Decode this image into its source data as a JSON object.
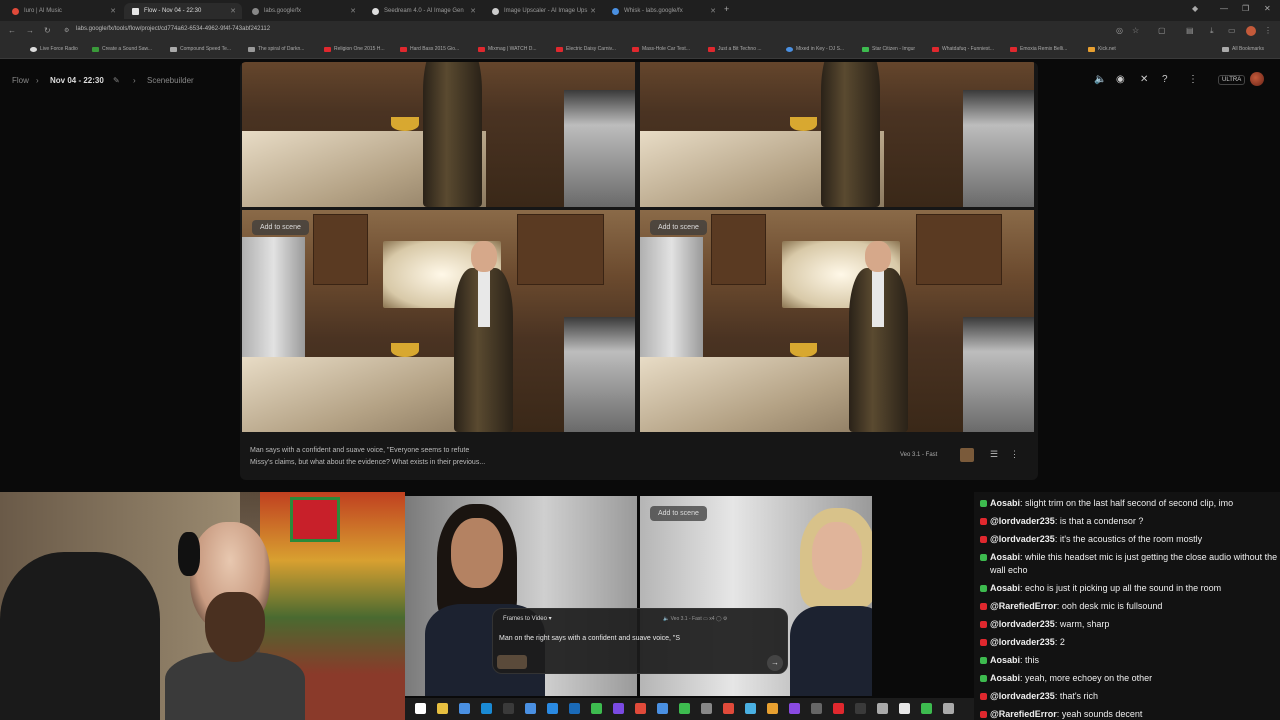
{
  "browser": {
    "tabs": [
      {
        "label": "Iuro | AI Music",
        "color": "#e04a3a",
        "active": false
      },
      {
        "label": "Flow - Nov 04 - 22:30",
        "color": "#e6e6e6",
        "active": true
      },
      {
        "label": "labs.google/fx",
        "color": "#888888",
        "active": false
      },
      {
        "label": "Seedream 4.0 - AI Image Gen",
        "color": "#dddddd",
        "active": false
      },
      {
        "label": "Image Upscaler - AI Image Ups",
        "color": "#cccccc",
        "active": false
      },
      {
        "label": "Whisk - labs.google/fx",
        "color": "#4a90e2",
        "active": false
      }
    ],
    "url": "labs.google/fx/tools/flow/project/cd774a62-6534-4962-9f4f-743abf242112",
    "bookmarks": [
      "Live Force Radio",
      "Create a Sound Saw...",
      "Compound Speed Te...",
      "The spiral of Darkn...",
      "Religion One 2015 H...",
      "Hard Bass 2015 Gio...",
      "Mixmag | WATCH D...",
      "Electric Daisy Carniv...",
      "Mass-Hole Car Test...",
      "Just a Bit Techno ...",
      "Mixed in Key - DJ S...",
      "Star Citizen - Imgur",
      "Whatdafuq - Funniest...",
      "Emoxia Remix Belli...",
      "Kick.net"
    ],
    "all_bookmarks": "All Bookmarks"
  },
  "app": {
    "breadcrumb": {
      "root": "Flow",
      "current": "Nov 04 - 22:30",
      "section": "Scenebuilder"
    },
    "ultra_badge": "ULTRA"
  },
  "scene": {
    "add_to_scene": "Add to scene",
    "prompt_line1": "Man says with a confident and suave voice, \"Everyone seems to refute",
    "prompt_line2": "Missy's claims, but what about the evidence? What exists in their previous...",
    "model": "Veo 3.1 - Fast"
  },
  "promptbox": {
    "mode": "Frames to Video",
    "model": "Veo 3.1 - Fast",
    "count": "x4",
    "text": "Man on the right says with a confident and suave voice, \"S"
  },
  "chat": [
    {
      "user": "Aosabi",
      "text": "slight trim on the last half second of second clip, imo",
      "kind": "green"
    },
    {
      "user": "@lordvader235",
      "text": "is that a condensor ?",
      "kind": "red"
    },
    {
      "user": "@lordvader235",
      "text": "it's the acoustics of the room mostly",
      "kind": "red"
    },
    {
      "user": "Aosabi",
      "text": "while this headset mic is just getting the close audio without the wall echo",
      "kind": "green"
    },
    {
      "user": "Aosabi",
      "text": "echo is just it picking up all the sound in the room",
      "kind": "green"
    },
    {
      "user": "@RarefiedError",
      "text": "ooh desk mic is fullsound",
      "kind": "red"
    },
    {
      "user": "@lordvader235",
      "text": "warm, sharp",
      "kind": "red"
    },
    {
      "user": "@lordvader235",
      "text": "2",
      "kind": "red"
    },
    {
      "user": "Aosabi",
      "text": "this",
      "kind": "green"
    },
    {
      "user": "Aosabi",
      "text": "yeah, more echoey on the other",
      "kind": "green"
    },
    {
      "user": "@lordvader235",
      "text": "that's rich",
      "kind": "red"
    },
    {
      "user": "@RarefiedError",
      "text": "yeah sounds decent",
      "kind": "red"
    }
  ],
  "colors": {
    "green": "#3dbb4f",
    "red": "#e0282e"
  }
}
